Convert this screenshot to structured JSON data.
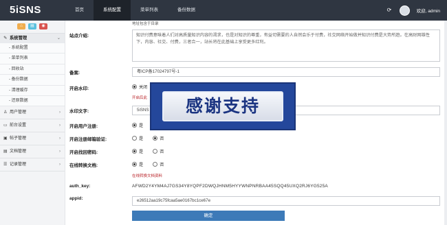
{
  "brand": "5iSNS",
  "nav": [
    "首页",
    "系统配置",
    "菜单列表",
    "备份数据"
  ],
  "user": {
    "welcome": "欢迎, admin"
  },
  "sidebar": {
    "quick_buttons": [
      "⌂",
      "▤",
      "◉"
    ],
    "group_open": {
      "label": "系统管理",
      "chevron": "⌄"
    },
    "sub_items": [
      "- 系统配置",
      "- 菜单列表",
      "- 回收站",
      "- 备份数据",
      "- 清理缓存",
      "- 还原数据"
    ],
    "groups": [
      {
        "label": "用户管理",
        "chevron": "›"
      },
      {
        "label": "前台设置",
        "chevron": "›"
      },
      {
        "label": "帖子管理",
        "chevron": "›"
      },
      {
        "label": "文档管理",
        "chevron": "›"
      },
      {
        "label": "记录管理",
        "chevron": "›"
      }
    ]
  },
  "form": {
    "hint_top": "地址包含于目录",
    "site_intro": {
      "label": "站点介绍:",
      "value": "知识付费意味着人们对高质量知识内容的渴求，也是对知识的尊重，有益切需要的人自然会乐于付费，社交网络开始做并知识付费是大势所趋。在高财网雄性下，内容、社交、付费，三者合一，站长将在此基础上享受更多红利。"
    },
    "icp": {
      "label": "备案:",
      "value": "粤ICP备17024797号-1"
    },
    "watermark": {
      "label": "开启水印:",
      "off": "关闭",
      "help": "开启后此"
    },
    "watermark_text": {
      "label": "水印文字:",
      "value": "5iSNS"
    },
    "register": {
      "label": "开启用户注册:",
      "yes": "是",
      "no": "否"
    },
    "email_verify": {
      "label": "开启注册邮箱验证:",
      "yes": "是",
      "no": "否"
    },
    "find_password": {
      "label": "开启找回密码:",
      "yes": "是",
      "no": "否"
    },
    "online_doc": {
      "label": "在线转换文档:",
      "yes": "是",
      "no": "否",
      "help": "在线转换文档资料"
    },
    "auth_key": {
      "label": "auth_key:",
      "value": "AFWD2Y4YM4AJ7GS34Y8YQPF2DWQJHNM5HYYWNPNRBAA45SQQ45UXQ2RJ6YG525A"
    },
    "appid": {
      "label": "appid:",
      "value": "e26512aa19c75fcaa5ae0167bc1ce67e"
    },
    "submit": "确定"
  },
  "overlay": {
    "text": "感谢支持"
  }
}
